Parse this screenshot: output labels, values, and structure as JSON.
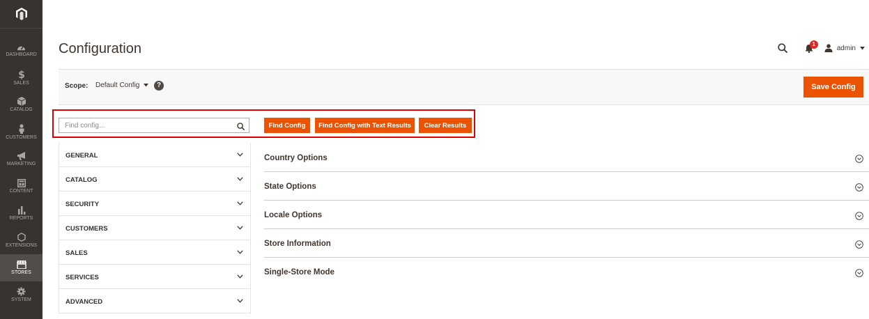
{
  "sidebar": {
    "items": [
      {
        "label": "DASHBOARD",
        "icon": "dashboard-icon"
      },
      {
        "label": "SALES",
        "icon": "dollar-icon"
      },
      {
        "label": "CATALOG",
        "icon": "box-icon"
      },
      {
        "label": "CUSTOMERS",
        "icon": "person-icon"
      },
      {
        "label": "MARKETING",
        "icon": "megaphone-icon"
      },
      {
        "label": "CONTENT",
        "icon": "layout-icon"
      },
      {
        "label": "REPORTS",
        "icon": "bar-chart-icon"
      },
      {
        "label": "EXTENSIONS",
        "icon": "hexagon-icon"
      },
      {
        "label": "STORES",
        "icon": "store-icon",
        "active": true
      },
      {
        "label": "SYSTEM",
        "icon": "gear-icon"
      }
    ]
  },
  "header": {
    "title": "Configuration",
    "notification_count": "1",
    "user": "admin"
  },
  "scope": {
    "label": "Scope:",
    "value": "Default Config",
    "help": "?",
    "save_label": "Save Config"
  },
  "search": {
    "placeholder": "Find config...",
    "value": "",
    "find_label": "Find Config",
    "find_text_label": "Find Config with Text Results",
    "clear_label": "Clear Results"
  },
  "tabs": [
    {
      "label": "GENERAL"
    },
    {
      "label": "CATALOG"
    },
    {
      "label": "SECURITY"
    },
    {
      "label": "CUSTOMERS"
    },
    {
      "label": "SALES"
    },
    {
      "label": "SERVICES"
    },
    {
      "label": "ADVANCED"
    }
  ],
  "sections": [
    {
      "label": "Country Options"
    },
    {
      "label": "State Options"
    },
    {
      "label": "Locale Options"
    },
    {
      "label": "Store Information"
    },
    {
      "label": "Single-Store Mode"
    }
  ],
  "colors": {
    "sidebar_bg": "#373330",
    "accent": "#eb5202",
    "highlight_frame": "#e00000",
    "notification": "#e22626"
  }
}
